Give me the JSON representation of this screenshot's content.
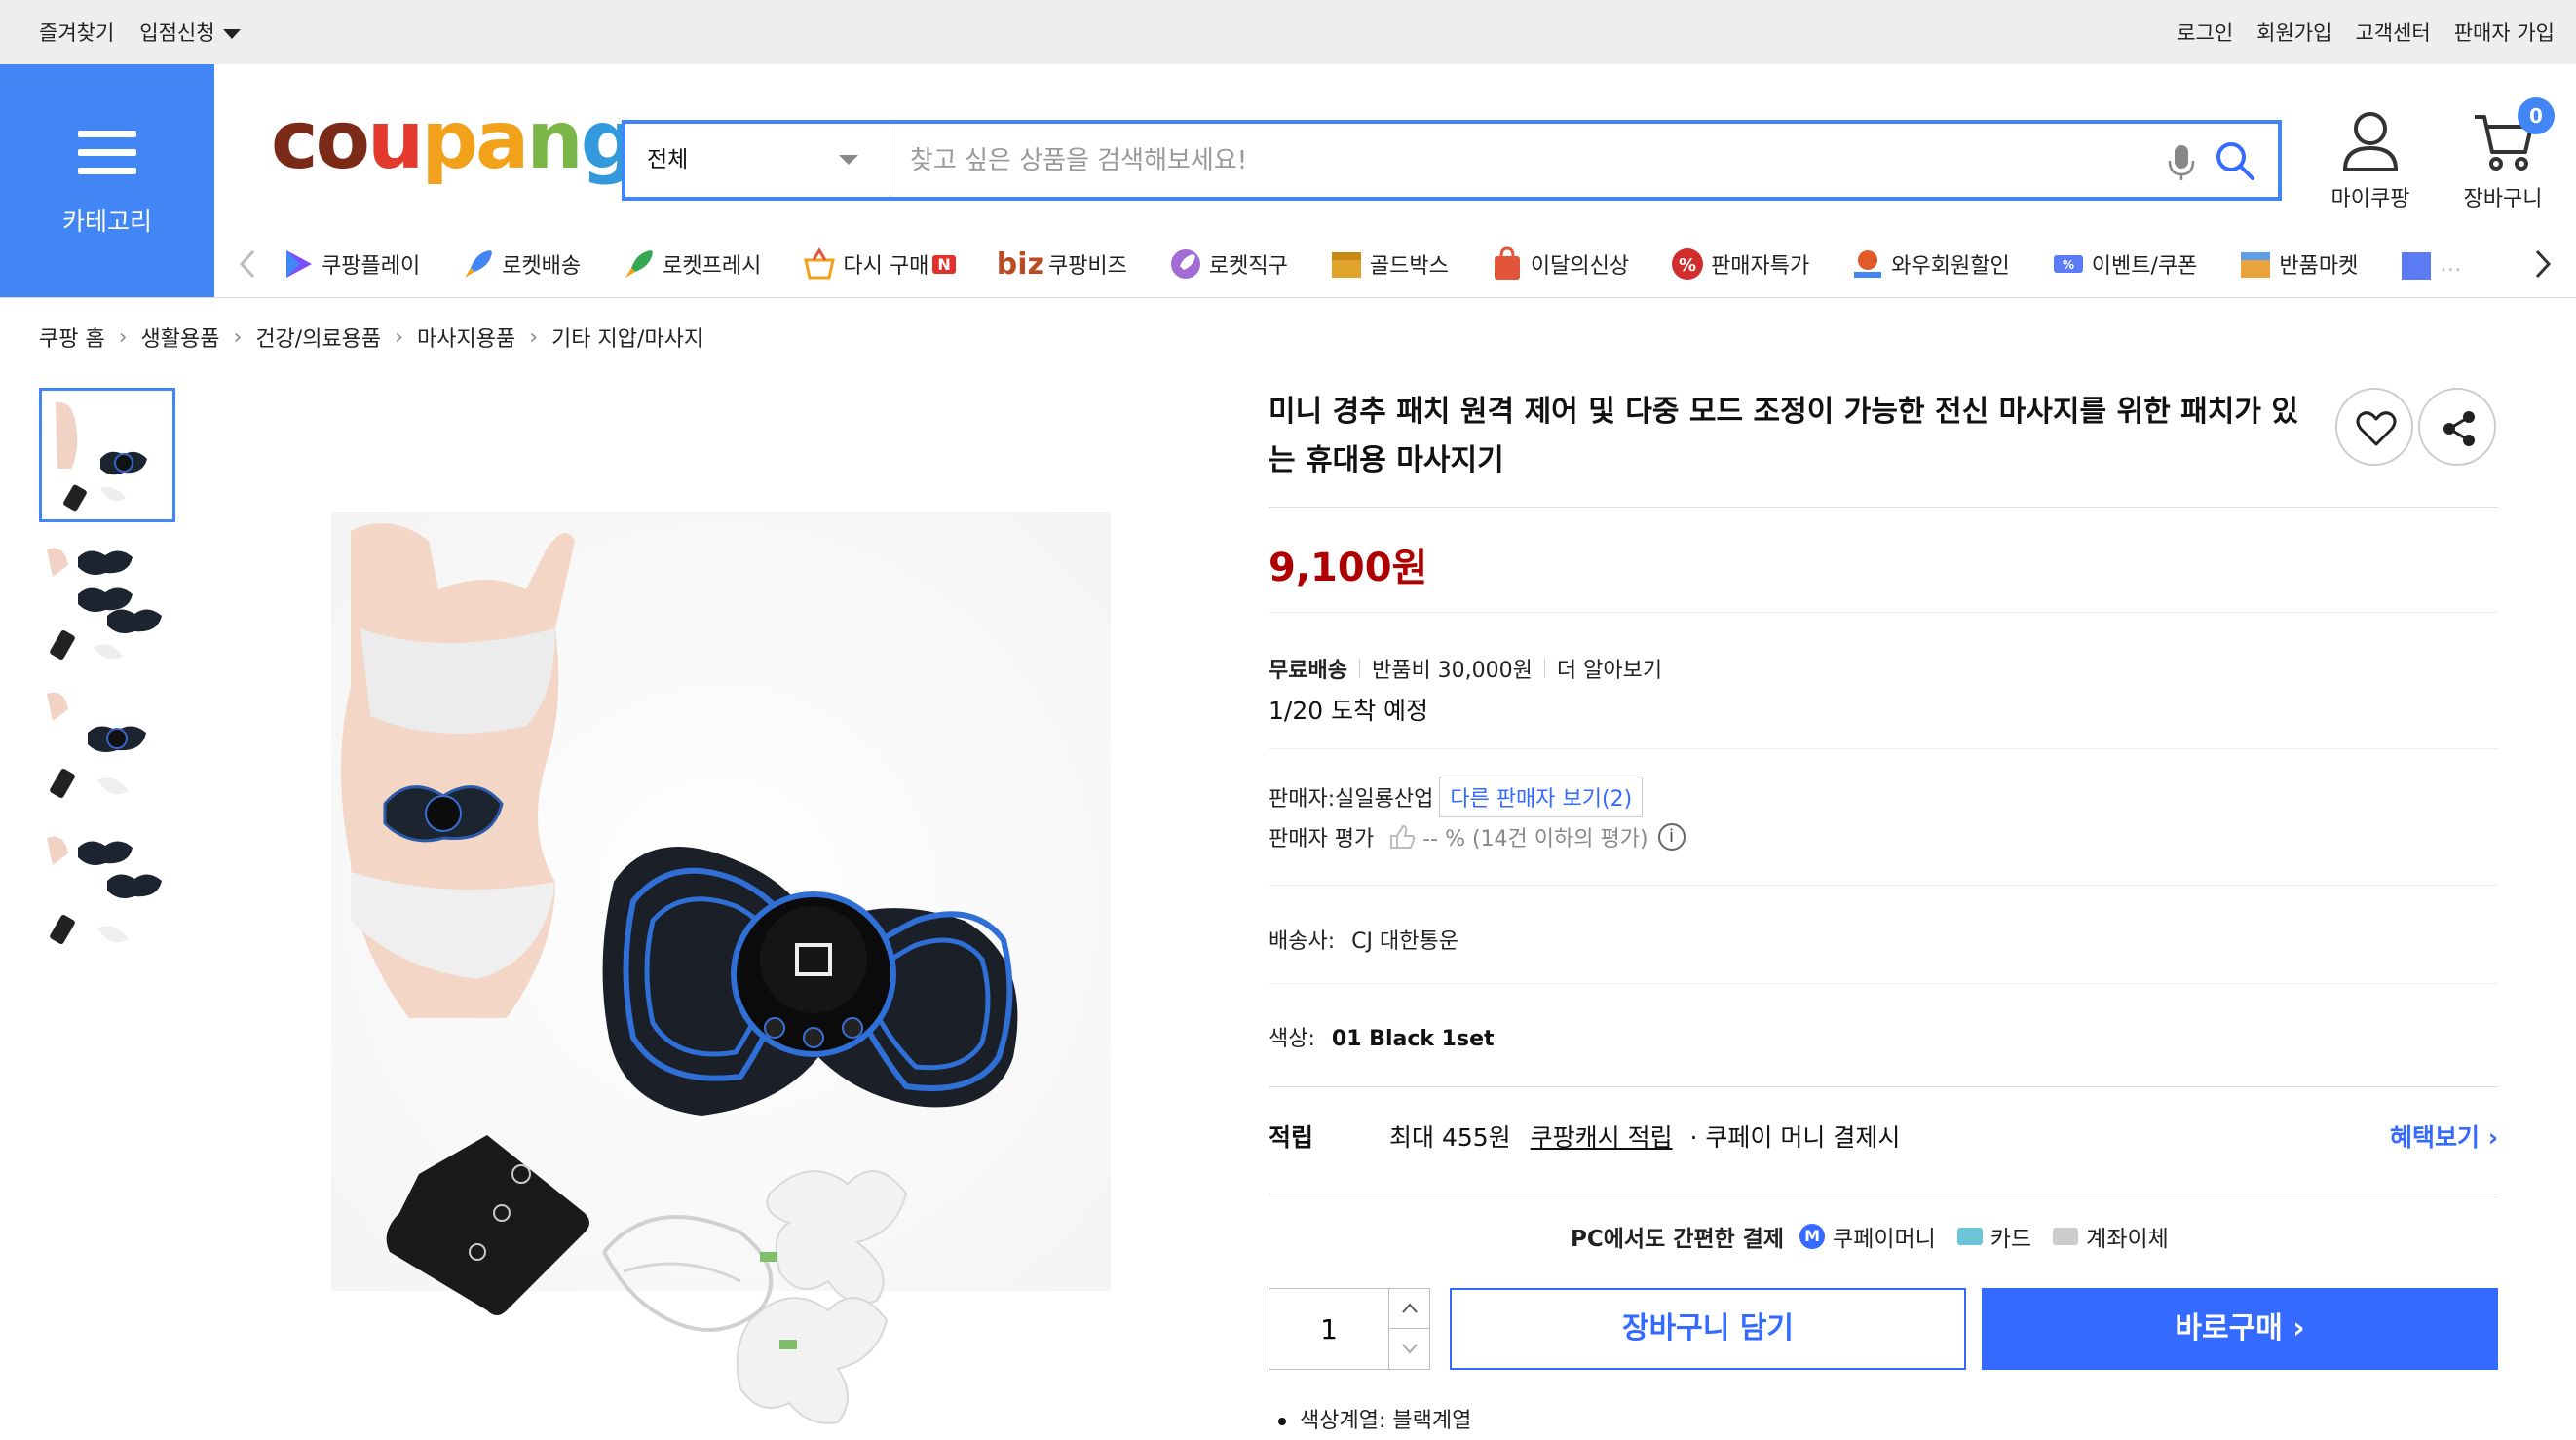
{
  "topbar": {
    "left": [
      "즐겨찾기",
      "입점신청"
    ],
    "right": [
      "로그인",
      "회원가입",
      "고객센터",
      "판매자 가입"
    ]
  },
  "category": {
    "label": "카테고리"
  },
  "logo": {
    "c": "c",
    "o": "o",
    "u": "u",
    "p": "p",
    "a": "a",
    "n": "n",
    "g": "g"
  },
  "search": {
    "category": "전체",
    "placeholder": "찾고 싶은 상품을 검색해보세요!"
  },
  "header_icons": {
    "mypage": "마이쿠팡",
    "cart": "장바구니",
    "cart_count": "0"
  },
  "nav": {
    "items": [
      {
        "label": "쿠팡플레이",
        "icon": "play-icon",
        "color": "#7c4dff"
      },
      {
        "label": "로켓배송",
        "icon": "rocket-icon",
        "color": "#4285f4"
      },
      {
        "label": "로켓프레시",
        "icon": "rocket-fresh-icon",
        "color": "#34a853"
      },
      {
        "label": "다시 구매",
        "icon": "basket-icon",
        "color": "#f2a11a"
      },
      {
        "label": "쿠팡비즈",
        "icon": "biz-icon",
        "color": "#b84d25"
      },
      {
        "label": "로켓직구",
        "icon": "rocket-global-icon",
        "color": "#a36bd6"
      },
      {
        "label": "골드박스",
        "icon": "goldbox-icon",
        "color": "#e0a42a"
      },
      {
        "label": "이달의신상",
        "icon": "new-bag-icon",
        "color": "#e2553a"
      },
      {
        "label": "판매자특가",
        "icon": "percent-icon",
        "color": "#d12d2d"
      },
      {
        "label": "와우회원할인",
        "icon": "wow-icon",
        "color": "#e05a2a"
      },
      {
        "label": "이벤트/쿠폰",
        "icon": "coupon-icon",
        "color": "#5c7cf5"
      },
      {
        "label": "반품마켓",
        "icon": "return-market-icon",
        "color": "#e8a33a"
      }
    ],
    "badge_n": "N",
    "biz_prefix": "biz",
    "last_partial": "…"
  },
  "breadcrumb": [
    "쿠팡 홈",
    "생활용품",
    "건강/의료용품",
    "마사지용품",
    "기타 지압/마사지"
  ],
  "product": {
    "title": "미니 경추 패치 원격 제어 및 다중 모드 조정이 가능한 전신 마사지를 위한 패치가 있는 휴대용 마사지기",
    "price": "9,100원",
    "shipping": {
      "free": "무료배송",
      "return_fee": "반품비 30,000원",
      "more": "더 알아보기",
      "eta": "1/20 도착 예정"
    },
    "seller": {
      "prefix": "판매자:",
      "name": "실일룡산업",
      "other": "다른 판매자 보기(2)"
    },
    "seller_rating": {
      "label": "판매자 평가",
      "value": "-- % (14건 이하의 평가)",
      "info": "i"
    },
    "carrier": {
      "label": "배송사:",
      "value": "CJ 대한통운"
    },
    "color": {
      "label": "색상:",
      "value": "01 Black 1set"
    },
    "points": {
      "label": "적립",
      "amount": "최대 455원",
      "cash": "쿠팡캐시 적립",
      "suffix": "· 쿠페이 머니 결제시",
      "more": "혜택보기 ›"
    },
    "payment": {
      "heading": "PC에서도 간편한 결제",
      "coupay_mark": "M",
      "coupay": "쿠페이머니",
      "card": "카드",
      "bank": "계좌이체"
    },
    "quantity": "1",
    "add_to_cart": "장바구니 담기",
    "buy_now": "바로구매 ›",
    "spec": "색상계열: 블랙계열"
  }
}
